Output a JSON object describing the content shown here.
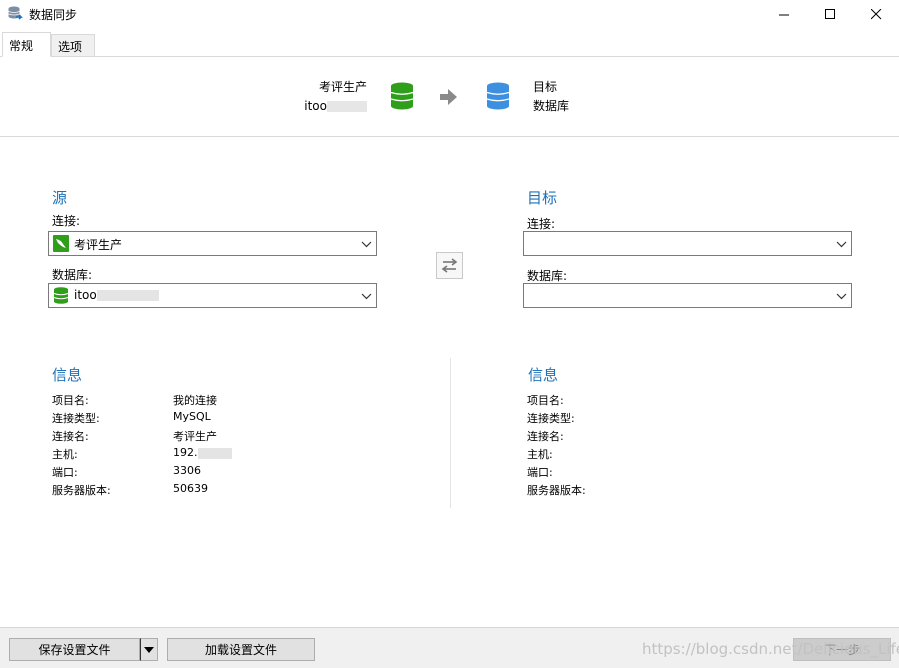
{
  "window": {
    "title": "数据同步"
  },
  "tabs": [
    {
      "label": "常规",
      "active": true
    },
    {
      "label": "选项",
      "active": false
    }
  ],
  "header": {
    "source_name": "考评生产",
    "source_db": "itoo",
    "target_line1": "目标",
    "target_line2": "数据库",
    "source_color": "#2e9e1b",
    "target_color": "#3d8fe0"
  },
  "source": {
    "title": "源",
    "connection_label": "连接:",
    "connection_value": "考评生产",
    "database_label": "数据库:",
    "database_value": "itoo"
  },
  "target": {
    "title": "目标",
    "connection_label": "连接:",
    "connection_value": "",
    "database_label": "数据库:",
    "database_value": ""
  },
  "source_info": {
    "title": "信息",
    "rows": [
      {
        "key": "项目名:",
        "value": "我的连接"
      },
      {
        "key": "连接类型:",
        "value": "MySQL"
      },
      {
        "key": "连接名:",
        "value": "考评生产"
      },
      {
        "key": "主机:",
        "value": "192."
      },
      {
        "key": "端口:",
        "value": "3306"
      },
      {
        "key": "服务器版本:",
        "value": "50639"
      }
    ]
  },
  "target_info": {
    "title": "信息",
    "rows": [
      {
        "key": "项目名:"
      },
      {
        "key": "连接类型:"
      },
      {
        "key": "连接名:"
      },
      {
        "key": "主机:"
      },
      {
        "key": "端口:"
      },
      {
        "key": "服务器版本:"
      }
    ]
  },
  "footer": {
    "save_label": "保存设置文件",
    "load_label": "加载设置文件",
    "next_label": "下一步",
    "watermark": "https://blog.csdn.net/Delicious_Life"
  }
}
